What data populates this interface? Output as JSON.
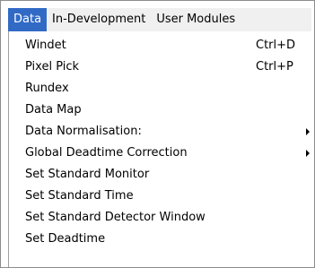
{
  "menubar": {
    "items": [
      {
        "label": "Data",
        "active": true
      },
      {
        "label": "In-Development",
        "active": false
      },
      {
        "label": "User Modules",
        "active": false
      }
    ]
  },
  "menu": {
    "items": [
      {
        "label": "Windet",
        "shortcut": "Ctrl+D"
      },
      {
        "label": "Pixel Pick",
        "shortcut": "Ctrl+P"
      },
      {
        "label": "Rundex"
      },
      {
        "label": "Data Map"
      },
      {
        "label": "Data Normalisation:",
        "submenu": true
      },
      {
        "label": "Global Deadtime Correction",
        "submenu": true
      },
      {
        "label": "Set Standard Monitor"
      },
      {
        "label": "Set Standard Time"
      },
      {
        "label": "Set Standard Detector Window"
      },
      {
        "label": "Set Deadtime"
      }
    ]
  },
  "colors": {
    "highlight": "#316ac5",
    "menubar_background": "#f0f0f0"
  },
  "icons": {
    "submenu_arrow": "chevron-right-icon"
  }
}
